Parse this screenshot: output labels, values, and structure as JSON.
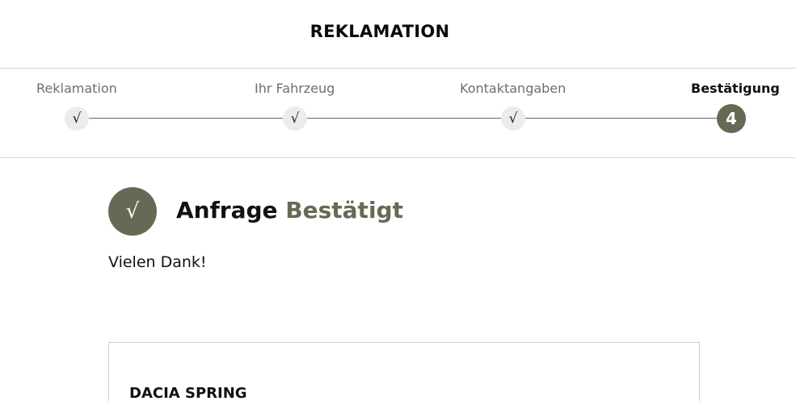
{
  "header": {
    "title": "REKLAMATION"
  },
  "stepper": {
    "steps": [
      {
        "label": "Reklamation",
        "marker": "√",
        "state": "completed"
      },
      {
        "label": "Ihr Fahrzeug",
        "marker": "√",
        "state": "completed"
      },
      {
        "label": "Kontaktangaben",
        "marker": "√",
        "state": "completed"
      },
      {
        "label": "Bestätigung",
        "marker": "4",
        "state": "active"
      }
    ]
  },
  "confirmation": {
    "icon": "check-icon",
    "icon_glyph": "√",
    "heading_main": "Anfrage",
    "heading_accent": "Bestätigt",
    "message": "Vielen Dank!"
  },
  "vehicle": {
    "name": "DACIA SPRING"
  },
  "colors": {
    "accent": "#666a55",
    "completed_step_bg": "#ececec",
    "divider": "#d6d6d6",
    "text": "#111111",
    "muted_text": "#6e6e6e"
  }
}
